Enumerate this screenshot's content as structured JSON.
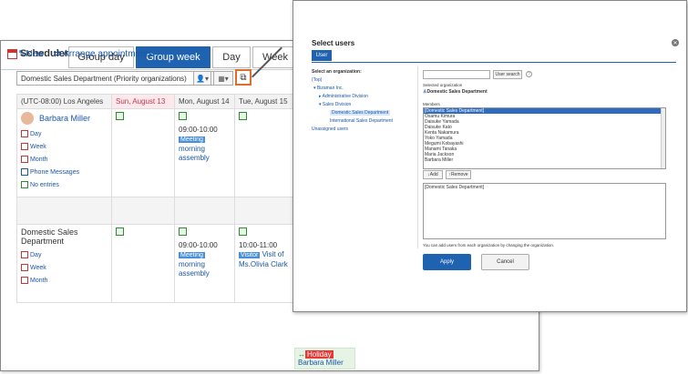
{
  "app": {
    "title": "Scheduler"
  },
  "tabs": [
    {
      "label": "Group day"
    },
    {
      "label": "Group week"
    },
    {
      "label": "Day"
    },
    {
      "label": "Week"
    }
  ],
  "actions": {
    "new": "New",
    "arrange": "Arrange appointments"
  },
  "org_select": {
    "value": "Domestic Sales Department (Priority organizations)"
  },
  "calendar": {
    "timezone": "(UTC-08:00) Los Angeles",
    "days": [
      "Sun, August 13",
      "Mon, August 14",
      "Tue, August 15"
    ],
    "user": {
      "name": "Barbara Miller",
      "links": [
        "Day",
        "Week",
        "Month",
        "Phone Messages",
        "No entries"
      ]
    },
    "org": {
      "name": "Domestic Sales Department",
      "links": [
        "Day",
        "Week",
        "Month"
      ]
    },
    "events": {
      "mon1": {
        "time": "09:00-10:00",
        "tag": "Meeting",
        "title": "morning assembly"
      },
      "mon2": {
        "time": "09:00-10:00",
        "tag": "Meeting",
        "title": "morning assembly"
      },
      "tue2": {
        "time": "10:00-11:00",
        "tag": "Visitor",
        "title": "Visit of Ms.Olivia Clark"
      }
    },
    "holiday": {
      "tag": "Holiday",
      "name": "Barbara Miller"
    }
  },
  "dialog": {
    "title": "Select users",
    "tab": "User",
    "org_header": "Select an organization:",
    "tree": [
      "(Top)",
      "Bizaman Inc.",
      "Administrative Division",
      "Sales Division",
      "Domestic Sales Department",
      "International Sales Department",
      "Unassigned users"
    ],
    "search_button": "User search",
    "selected_org_label": "Selected organization",
    "selected_org": "Domestic Sales Department",
    "members_label": "Members",
    "members": [
      "[Domestic Sales Department]",
      "Osamu Kimura",
      "Daisuke Yamada",
      "Daisuke Kato",
      "Kenta Nakamura",
      "Yoko Yamada",
      "Megumi Kobayashi",
      "Manami Tanaka",
      "Maria Jackson",
      "Barbara Miller"
    ],
    "add": "↓Add",
    "remove": "↑Remove",
    "selected": [
      "[Domestic Sales Department]"
    ],
    "note": "You can add users from each organization by changing the organization.",
    "apply": "Apply",
    "cancel": "Cancel"
  }
}
